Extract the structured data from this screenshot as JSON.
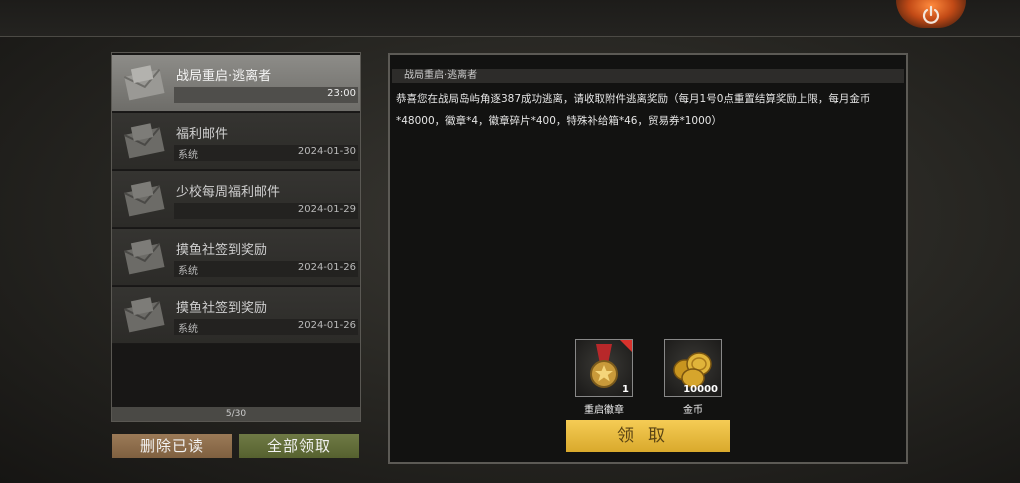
{
  "mail_list": {
    "items": [
      {
        "title": "战局重启·逃离者",
        "sender": "",
        "date": "23:00",
        "selected": true
      },
      {
        "title": "福利邮件",
        "sender": "系统",
        "date": "2024-01-30",
        "selected": false
      },
      {
        "title": "少校每周福利邮件",
        "sender": "",
        "date": "2024-01-29",
        "selected": false
      },
      {
        "title": "摸鱼社签到奖励",
        "sender": "系统",
        "date": "2024-01-26",
        "selected": false
      },
      {
        "title": "摸鱼社签到奖励",
        "sender": "系统",
        "date": "2024-01-26",
        "selected": false
      }
    ],
    "pager": "5/30"
  },
  "actions": {
    "delete_read": "删除已读",
    "claim_all": "全部领取"
  },
  "detail": {
    "title": "战局重启·逃离者",
    "body": "恭喜您在战局岛屿角逐387成功逃离，请收取附件逃离奖励（每月1号0点重置结算奖励上限，每月金币*48000，徽章*4，徽章碎片*400，特殊补给箱*46，贸易券*1000）",
    "rewards": [
      {
        "name": "重启徽章",
        "qty": "1",
        "icon": "medal-icon"
      },
      {
        "name": "金币",
        "qty": "10000",
        "icon": "gold-coins-icon"
      }
    ],
    "claim_label": "领取"
  },
  "colors": {
    "accent_gold": "#f5cc55",
    "delete_button": "#9b7a57",
    "claim_all_button": "#6f7a45",
    "power_glow": "#ff8a3d"
  }
}
